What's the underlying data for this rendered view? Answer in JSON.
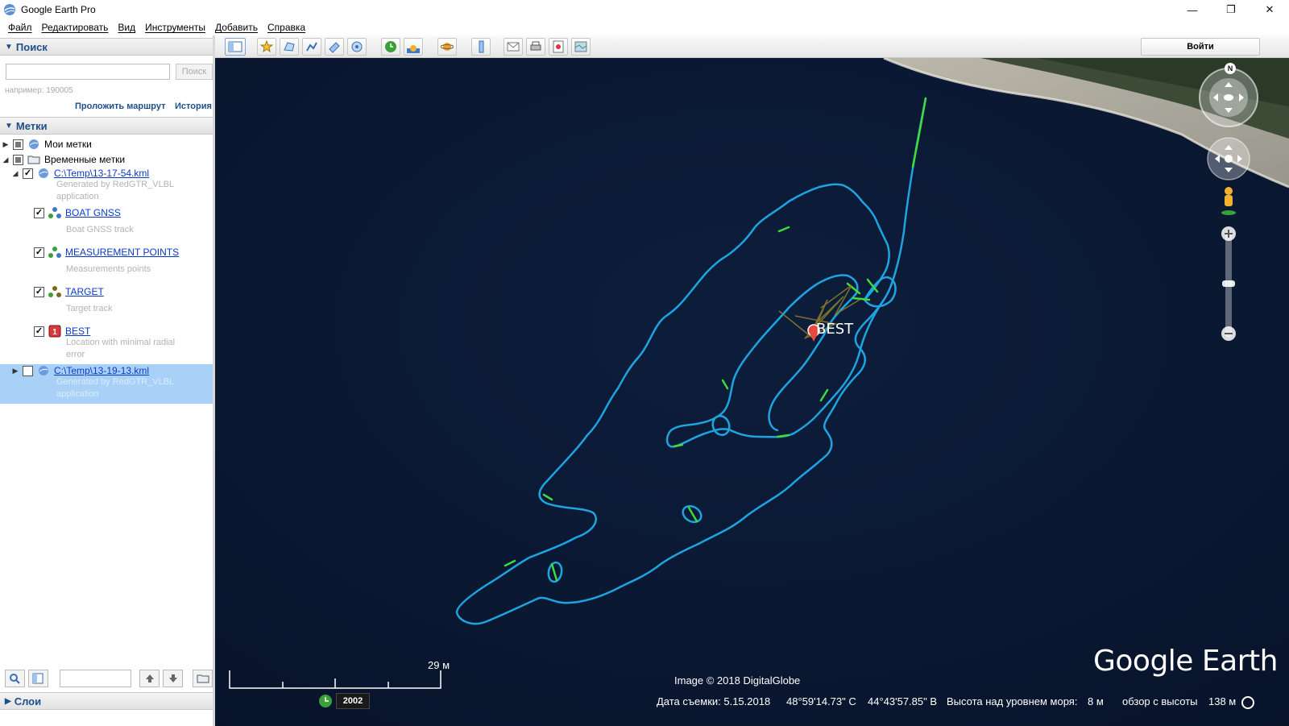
{
  "window": {
    "title": "Google Earth Pro",
    "minimize": "—",
    "restore": "❐",
    "close": "✕"
  },
  "menu": [
    "Файл",
    "Редактировать",
    "Вид",
    "Инструменты",
    "Добавить",
    "Справка"
  ],
  "search_panel": {
    "header": "Поиск",
    "input_value": "",
    "button": "Поиск",
    "hint": "например: 190005",
    "route_link": "Проложить маршрут",
    "history_link": "История"
  },
  "places_panel": {
    "header": "Метки",
    "items": {
      "my_places": "Мои метки",
      "temp_places": "Временные метки",
      "kml1": {
        "label": "C:\\Temp\\13-17-54.kml",
        "desc1": "Generated by RedGTR_VLBL",
        "desc2": "application"
      },
      "boat": {
        "label": "BOAT GNSS",
        "desc": "Boat GNSS track"
      },
      "meas": {
        "label": "MEASUREMENT POINTS",
        "desc": "Measurements points"
      },
      "target": {
        "label": "TARGET",
        "desc": "Target track"
      },
      "best": {
        "label": "BEST",
        "desc1": "Location with minimal radial",
        "desc2": "error"
      },
      "kml2": {
        "label": "C:\\Temp\\13-19-13.kml",
        "desc1": "Generated by RedGTR_VLBL",
        "desc2": "application"
      }
    }
  },
  "layers_panel": {
    "header": "Слои"
  },
  "toolbar": {
    "signin": "Войти"
  },
  "map": {
    "placemark_label": "BEST",
    "scale": "29 м",
    "copyright": "Image © 2018 DigitalGlobe",
    "brand": "Google Earth",
    "north": "N",
    "year": "2002",
    "status": {
      "date": "Дата съемки: 5.15.2018",
      "lat": "48°59'14.73\" С",
      "lon": "44°43'57.85\" В",
      "elev_label": "Высота над уровнем моря:",
      "elev_value": "8 м",
      "eye_label": "обзор с высоты",
      "eye_value": "138 м"
    },
    "colors": {
      "track": "#1ea4e0",
      "highlight": "#3ddc3a",
      "water": "#0a1630",
      "target": "#8a7a2a"
    }
  }
}
